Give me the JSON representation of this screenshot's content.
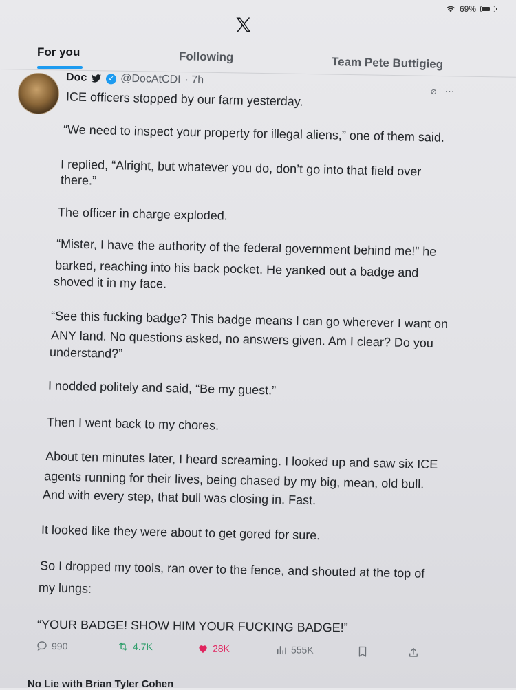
{
  "status": {
    "battery_text": "69%",
    "battery_level": 0.69
  },
  "tabs": [
    {
      "label": "For you",
      "active": true
    },
    {
      "label": "Following",
      "active": false
    },
    {
      "label": "Team Pete Buttigieg",
      "active": false
    }
  ],
  "post": {
    "display_name": "Doc",
    "handle": "@DocAtCDI",
    "time": "· 7h",
    "lines": [
      "ICE officers stopped by our farm yesterday.",
      "“We need to inspect your property for illegal aliens,” one of them said.",
      "I replied, “Alright, but whatever you do, don’t go into that field over",
      "there.”",
      "The officer in charge exploded.",
      "“Mister, I have the authority of the federal government behind me!” he",
      "barked, reaching into his back pocket. He yanked out a badge and",
      "shoved it in my face.",
      "“See this fucking badge? This badge means I can go wherever I want on",
      "ANY land. No questions asked, no answers given. Am I clear? Do you",
      "understand?”",
      "I nodded politely and said, “Be my guest.”",
      "Then I went back to my chores.",
      "About ten minutes later, I heard screaming. I looked up and saw six ICE",
      "agents running for their lives, being chased by my big, mean, old bull.",
      "And with every step, that bull was closing in. Fast.",
      "It looked like they were about to get gored for sure.",
      "So I dropped my tools, ran over to the fence, and shouted at the top of",
      "my lungs:",
      "“YOUR BADGE! SHOW HIM YOUR FUCKING BADGE!”"
    ],
    "actions": {
      "replies": "990",
      "reposts": "4.7K",
      "likes": "28K",
      "views": "555K"
    }
  },
  "next_post": {
    "text": "No Lie with Brian Tyler Cohen"
  },
  "icons": [
    "wifi-icon",
    "battery-icon",
    "x-logo-icon",
    "bird-icon",
    "verified-icon",
    "grok-icon",
    "more-icon",
    "reply-icon",
    "repost-icon",
    "like-icon",
    "views-icon",
    "bookmark-icon",
    "share-icon"
  ],
  "colors": {
    "accent": "#1d9bf0",
    "repost": "#2f9e6b",
    "like": "#e0245e"
  }
}
